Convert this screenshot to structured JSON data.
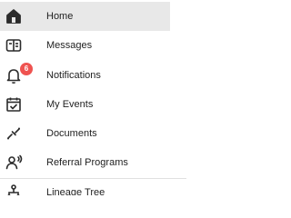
{
  "sidebar": {
    "items": [
      {
        "label": "Home",
        "icon": "home-icon",
        "active": true
      },
      {
        "label": "Messages",
        "icon": "messages-icon",
        "active": false
      },
      {
        "label": "Notifications",
        "icon": "bell-icon",
        "active": false,
        "badge": "6"
      },
      {
        "label": "My Events",
        "icon": "calendar-check-icon",
        "active": false
      },
      {
        "label": "Documents",
        "icon": "document-link-icon",
        "active": false
      },
      {
        "label": "Referral Programs",
        "icon": "referral-icon",
        "active": false
      },
      {
        "label": "Lineage Tree",
        "icon": "tree-icon",
        "active": false
      }
    ]
  },
  "colors": {
    "active_background": "#e8e8e8",
    "text": "#1f1f1f",
    "icon": "#2b2b2b",
    "badge": "#ef5350"
  }
}
